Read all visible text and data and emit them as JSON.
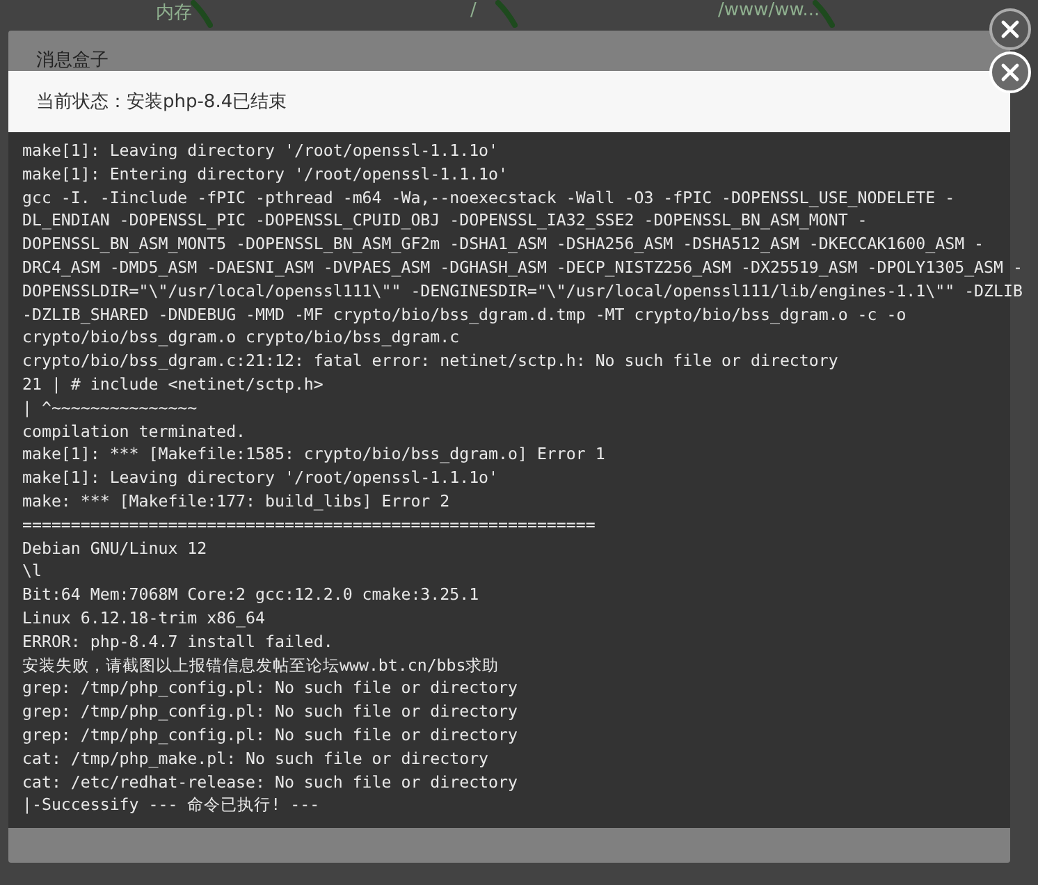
{
  "background": {
    "gauges": [
      {
        "label": "内存"
      },
      {
        "label": "/"
      },
      {
        "label": "/www/ww..."
      }
    ]
  },
  "back_dialog": {
    "title": "消息盒子"
  },
  "dialog": {
    "status": "当前状态：安装php-8.4已结束",
    "log": [
      "make[1]: Leaving directory '/root/openssl-1.1.1o'",
      "make[1]: Entering directory '/root/openssl-1.1.1o'",
      "gcc -I. -Iinclude -fPIC -pthread -m64 -Wa,--noexecstack -Wall -O3 -fPIC -DOPENSSL_USE_NODELETE -",
      "DL_ENDIAN -DOPENSSL_PIC -DOPENSSL_CPUID_OBJ -DOPENSSL_IA32_SSE2 -DOPENSSL_BN_ASM_MONT -",
      "DOPENSSL_BN_ASM_MONT5 -DOPENSSL_BN_ASM_GF2m -DSHA1_ASM -DSHA256_ASM -DSHA512_ASM -DKECCAK1600_ASM -",
      "DRC4_ASM -DMD5_ASM -DAESNI_ASM -DVPAES_ASM -DGHASH_ASM -DECP_NISTZ256_ASM -DX25519_ASM -DPOLY1305_ASM -",
      "DOPENSSLDIR=\"\\\"/usr/local/openssl111\\\"\" -DENGINESDIR=\"\\\"/usr/local/openssl111/lib/engines-1.1\\\"\" -DZLIB",
      "-DZLIB_SHARED -DNDEBUG -MMD -MF crypto/bio/bss_dgram.d.tmp -MT crypto/bio/bss_dgram.o -c -o",
      "crypto/bio/bss_dgram.o crypto/bio/bss_dgram.c",
      "crypto/bio/bss_dgram.c:21:12: fatal error: netinet/sctp.h: No such file or directory",
      "21 | # include <netinet/sctp.h>",
      "| ^~~~~~~~~~~~~~~~",
      "compilation terminated.",
      "make[1]: *** [Makefile:1585: crypto/bio/bss_dgram.o] Error 1",
      "make[1]: Leaving directory '/root/openssl-1.1.1o'",
      "make: *** [Makefile:177: build_libs] Error 2",
      "===========================================================",
      "Debian GNU/Linux 12",
      "\\l",
      "Bit:64 Mem:7068M Core:2 gcc:12.2.0 cmake:3.25.1",
      "Linux 6.12.18-trim x86_64",
      "ERROR: php-8.4.7 install failed.",
      "安装失败，请截图以上报错信息发帖至论坛www.bt.cn/bbs求助",
      "grep: /tmp/php_config.pl: No such file or directory",
      "grep: /tmp/php_config.pl: No such file or directory",
      "grep: /tmp/php_config.pl: No such file or directory",
      "cat: /tmp/php_make.pl: No such file or directory",
      "cat: /etc/redhat-release: No such file or directory",
      "|-Successify --- 命令已执行! ---"
    ]
  }
}
